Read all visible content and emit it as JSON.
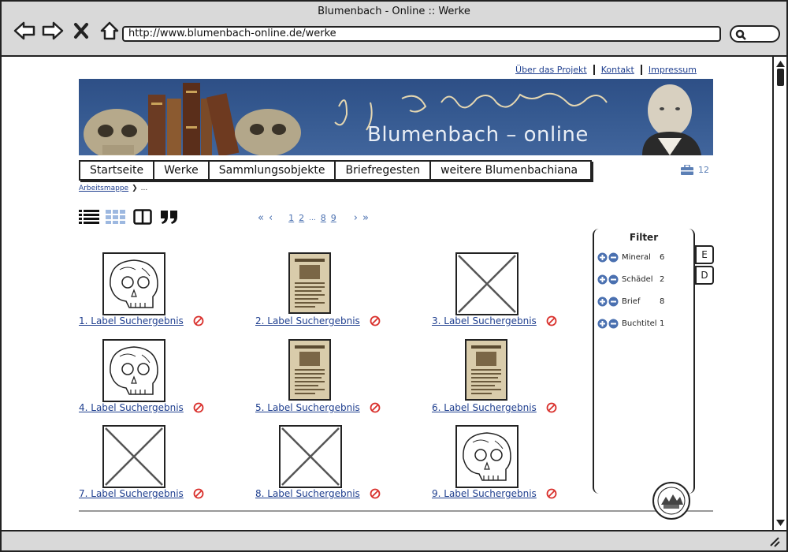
{
  "window": {
    "title": "Blumenbach - Online :: Werke"
  },
  "browser": {
    "url": "http://www.blumenbach-online.de/werke",
    "nav_icons": [
      "back-icon",
      "forward-icon",
      "close-icon",
      "home-icon"
    ],
    "search_icon": "search-icon"
  },
  "toplinks": [
    "Über das Projekt",
    "Kontakt",
    "Impressum"
  ],
  "banner": {
    "title": "Blumenbach – online"
  },
  "mainnav": [
    "Startseite",
    "Werke",
    "Sammlungsobjekte",
    "Briefregesten",
    "weitere Blumenbachiana"
  ],
  "cart": {
    "icon": "briefcase-icon",
    "count": "12"
  },
  "breadcrumb": {
    "link": "Arbeitsmappe",
    "sep": "❯",
    "rest": "..."
  },
  "views": [
    "list-view-icon",
    "grid-view-icon",
    "split-view-icon",
    "quote-icon"
  ],
  "pager": {
    "first": "«",
    "prev": "‹",
    "pages": [
      "1",
      "2",
      "...",
      "8",
      "9"
    ],
    "next": "›",
    "last": "»"
  },
  "results": [
    {
      "label": "1. Label Suchergebnis",
      "type": "skull"
    },
    {
      "label": "2. Label Suchergebnis",
      "type": "document"
    },
    {
      "label": "3. Label Suchergebnis",
      "type": "placeholder"
    },
    {
      "label": "4. Label Suchergebnis",
      "type": "skull"
    },
    {
      "label": "5. Label Suchergebnis",
      "type": "document"
    },
    {
      "label": "6. Label Suchergebnis",
      "type": "document"
    },
    {
      "label": "7. Label Suchergebnis",
      "type": "placeholder"
    },
    {
      "label": "8. Label Suchergebnis",
      "type": "placeholder"
    },
    {
      "label": "9. Label Suchergebnis",
      "type": "skull"
    }
  ],
  "filter": {
    "title": "Filter",
    "items": [
      {
        "label": "Mineral",
        "count": "6"
      },
      {
        "label": "Schädel",
        "count": "2"
      },
      {
        "label": "Brief",
        "count": "8"
      },
      {
        "label": "Buchtitel",
        "count": "1"
      }
    ]
  },
  "sidetabs": [
    "E",
    "D"
  ],
  "colors": {
    "link": "#1f3f8f",
    "banner": "#34588f",
    "accent": "#4a70b0",
    "remove": "#d9302c"
  }
}
